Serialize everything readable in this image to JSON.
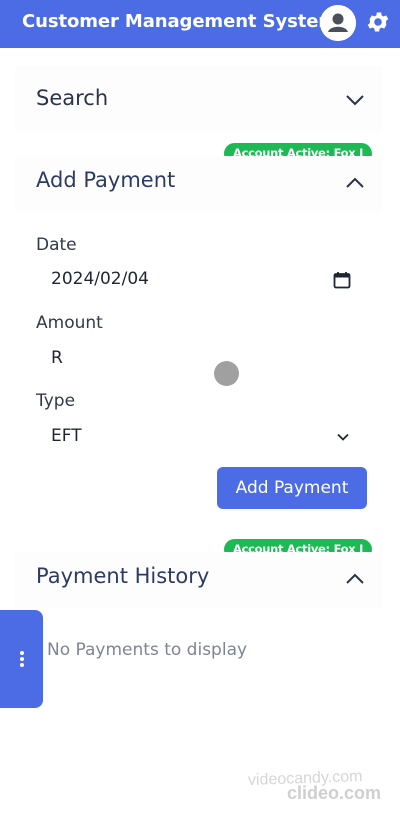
{
  "header": {
    "title": "Customer Management System",
    "avatar_icon": "user-circle-icon",
    "settings_icon": "gear-icon",
    "bg_color": "#4c6ce6"
  },
  "search_panel": {
    "title": "Search",
    "chevron_icon": "chevron-down-icon"
  },
  "add_payment_panel": {
    "badge": "Account Active: Fox J",
    "title": "Add Payment",
    "chevron_icon": "chevron-up-icon",
    "date_label": "Date",
    "date_value": "2024/02/04",
    "calendar_icon": "calendar-icon",
    "amount_label": "Amount",
    "amount_prefix": "R",
    "type_label": "Type",
    "type_value": "EFT",
    "submit_label": "Add Payment"
  },
  "history_panel": {
    "badge": "Account Active: Fox J",
    "title": "Payment History",
    "chevron_icon": "chevron-up-icon",
    "empty_text": "No Payments to display"
  },
  "side_tab": {
    "icon": "more-vertical-icon"
  },
  "watermark": {
    "line1": "videocandy.com",
    "line2": "clideo.com"
  },
  "colors": {
    "primary": "#4c6ce6",
    "badge": "#1db954"
  }
}
